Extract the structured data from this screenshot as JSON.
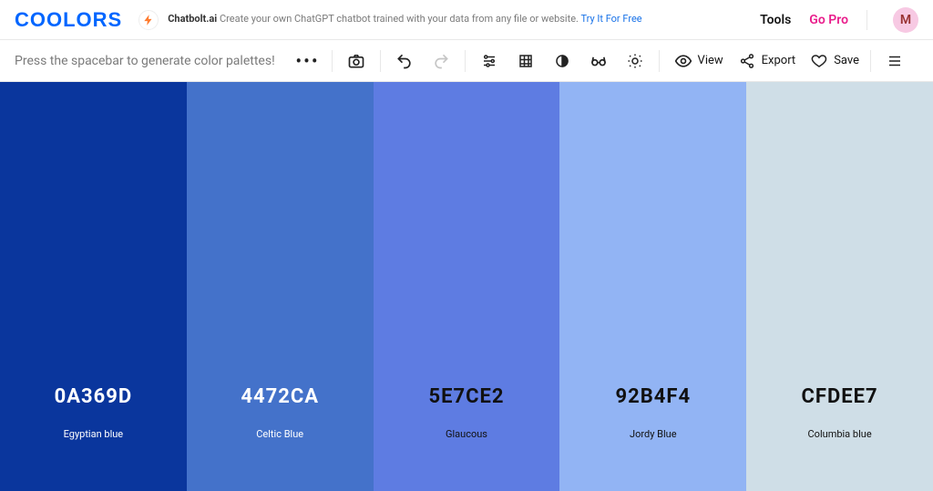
{
  "logo": "COOLORS",
  "sponsor": {
    "title": "Chatbolt.ai",
    "text": "Create your own ChatGPT chatbot trained with your data from any file or website.",
    "link": "Try It For Free"
  },
  "topbar": {
    "tools": "Tools",
    "go_pro": "Go Pro",
    "avatar_initial": "M"
  },
  "toolbar": {
    "hint": "Press the spacebar to generate color palettes!",
    "view": "View",
    "export": "Export",
    "save": "Save"
  },
  "palette": [
    {
      "hex": "0A369D",
      "name": "Egyptian blue",
      "bg": "#0A369D",
      "tone": "light"
    },
    {
      "hex": "4472CA",
      "name": "Celtic Blue",
      "bg": "#4472CA",
      "tone": "light"
    },
    {
      "hex": "5E7CE2",
      "name": "Glaucous",
      "bg": "#5E7CE2",
      "tone": "dark"
    },
    {
      "hex": "92B4F4",
      "name": "Jordy Blue",
      "bg": "#92B4F4",
      "tone": "dark"
    },
    {
      "hex": "CFDEE7",
      "name": "Columbia blue",
      "bg": "#CFDEE7",
      "tone": "dark"
    }
  ]
}
